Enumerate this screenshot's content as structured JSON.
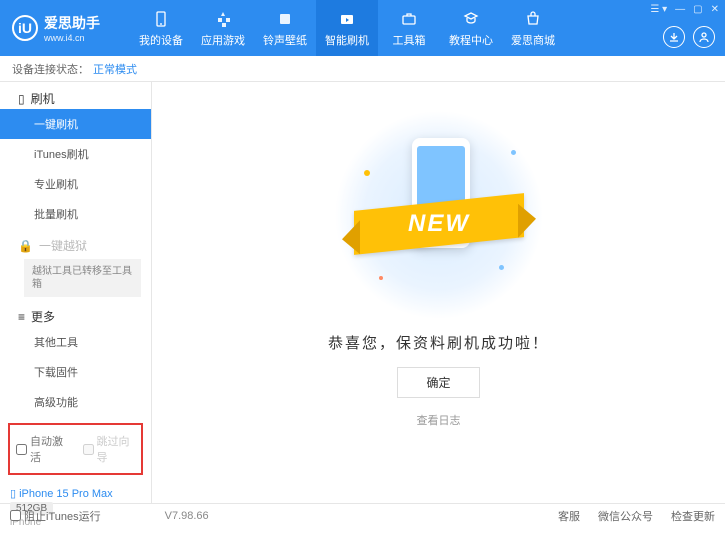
{
  "header": {
    "logo_letter": "iU",
    "logo_title": "爱思助手",
    "logo_sub": "www.i4.cn",
    "nav": [
      {
        "label": "我的设备"
      },
      {
        "label": "应用游戏"
      },
      {
        "label": "铃声壁纸"
      },
      {
        "label": "智能刷机"
      },
      {
        "label": "工具箱"
      },
      {
        "label": "教程中心"
      },
      {
        "label": "爱思商城"
      }
    ]
  },
  "status": {
    "label": "设备连接状态：",
    "value": "正常模式"
  },
  "sidebar": {
    "groups": {
      "flash": {
        "title": "刷机",
        "items": [
          "一键刷机",
          "iTunes刷机",
          "专业刷机",
          "批量刷机"
        ]
      },
      "jailbreak": {
        "title": "一键越狱",
        "note": "越狱工具已转移至工具箱"
      },
      "more": {
        "title": "更多",
        "items": [
          "其他工具",
          "下载固件",
          "高级功能"
        ]
      }
    },
    "checks": {
      "auto": "自动激活",
      "skip": "跳过向导"
    },
    "device": {
      "name": "iPhone 15 Pro Max",
      "storage": "512GB",
      "type": "iPhone"
    }
  },
  "main": {
    "ribbon": "NEW",
    "message": "恭喜您，保资料刷机成功啦！",
    "ok": "确定",
    "log": "查看日志"
  },
  "footer": {
    "block": "阻止iTunes运行",
    "version": "V7.98.66",
    "links": [
      "客服",
      "微信公众号",
      "检查更新"
    ]
  }
}
